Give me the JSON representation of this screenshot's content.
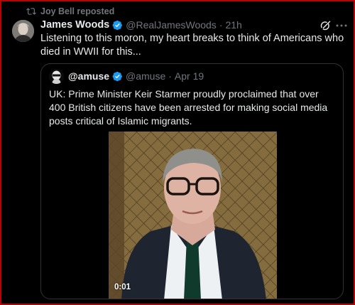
{
  "repost": {
    "text": "Joy Bell reposted",
    "icon": "repost-icon"
  },
  "tweet": {
    "author_name": "James Woods",
    "author_handle": "@RealJamesWoods",
    "separator": "·",
    "time": "21h",
    "text": "Listening to this moron, my heart breaks to think of Americans who died in WWII for this...",
    "icons": [
      "verified-badge-icon",
      "grok-icon",
      "more-icon"
    ]
  },
  "quote": {
    "author_name": "@amuse",
    "author_handle": "@amuse",
    "separator": "·",
    "date": "Apr 19",
    "text": "UK: Prime Minister Keir Starmer proudly proclaimed that over 400 British citizens have been arrested for making social media posts critical of Islamic migrants.",
    "video_duration": "0:01"
  },
  "colors": {
    "background": "#000000",
    "text_primary": "#e7e9ea",
    "text_secondary": "#71767b",
    "verified_blue": "#1d9bf0",
    "border": "#2f3336",
    "frame_red": "#b40404"
  }
}
